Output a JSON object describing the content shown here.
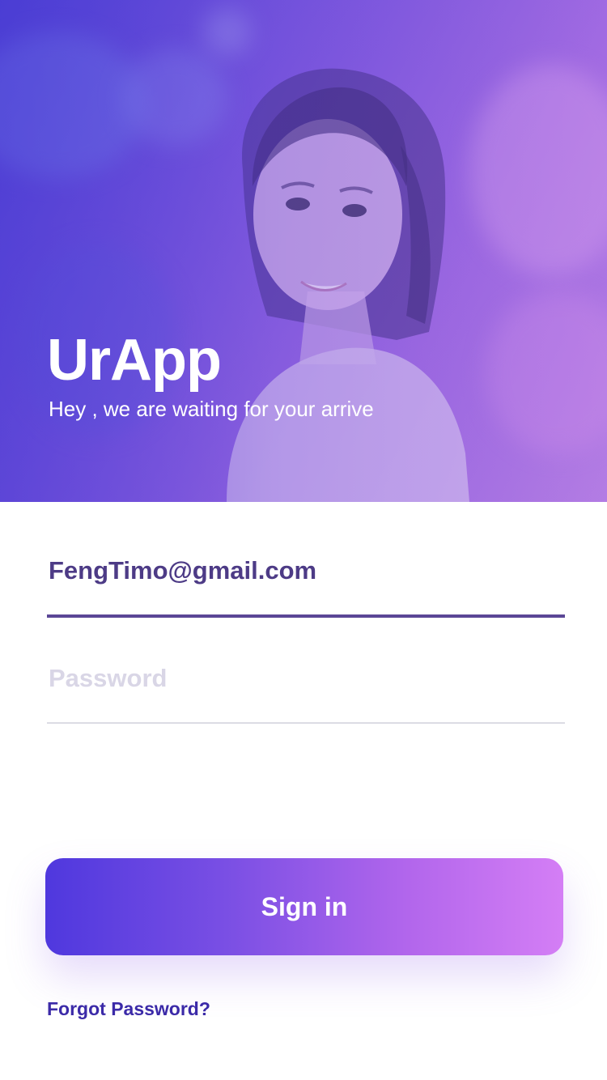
{
  "app": {
    "title": "UrApp",
    "subtitle": "Hey , we are waiting for your arrive"
  },
  "hero": {
    "image": "portrait-photo",
    "overlay_colors": [
      "#4a3fd6",
      "#a06ae2",
      "#b57fe4"
    ]
  },
  "form": {
    "email": {
      "value": "FengTimo@gmail.com",
      "underline_color": "#5b4796"
    },
    "password": {
      "value": "",
      "placeholder": "Password",
      "underline_color": "#dcdce4"
    }
  },
  "actions": {
    "signin_label": "Sign in",
    "forgot_label": "Forgot Password?",
    "signin_gradient": [
      "#4f38de",
      "#d47ef5"
    ]
  }
}
